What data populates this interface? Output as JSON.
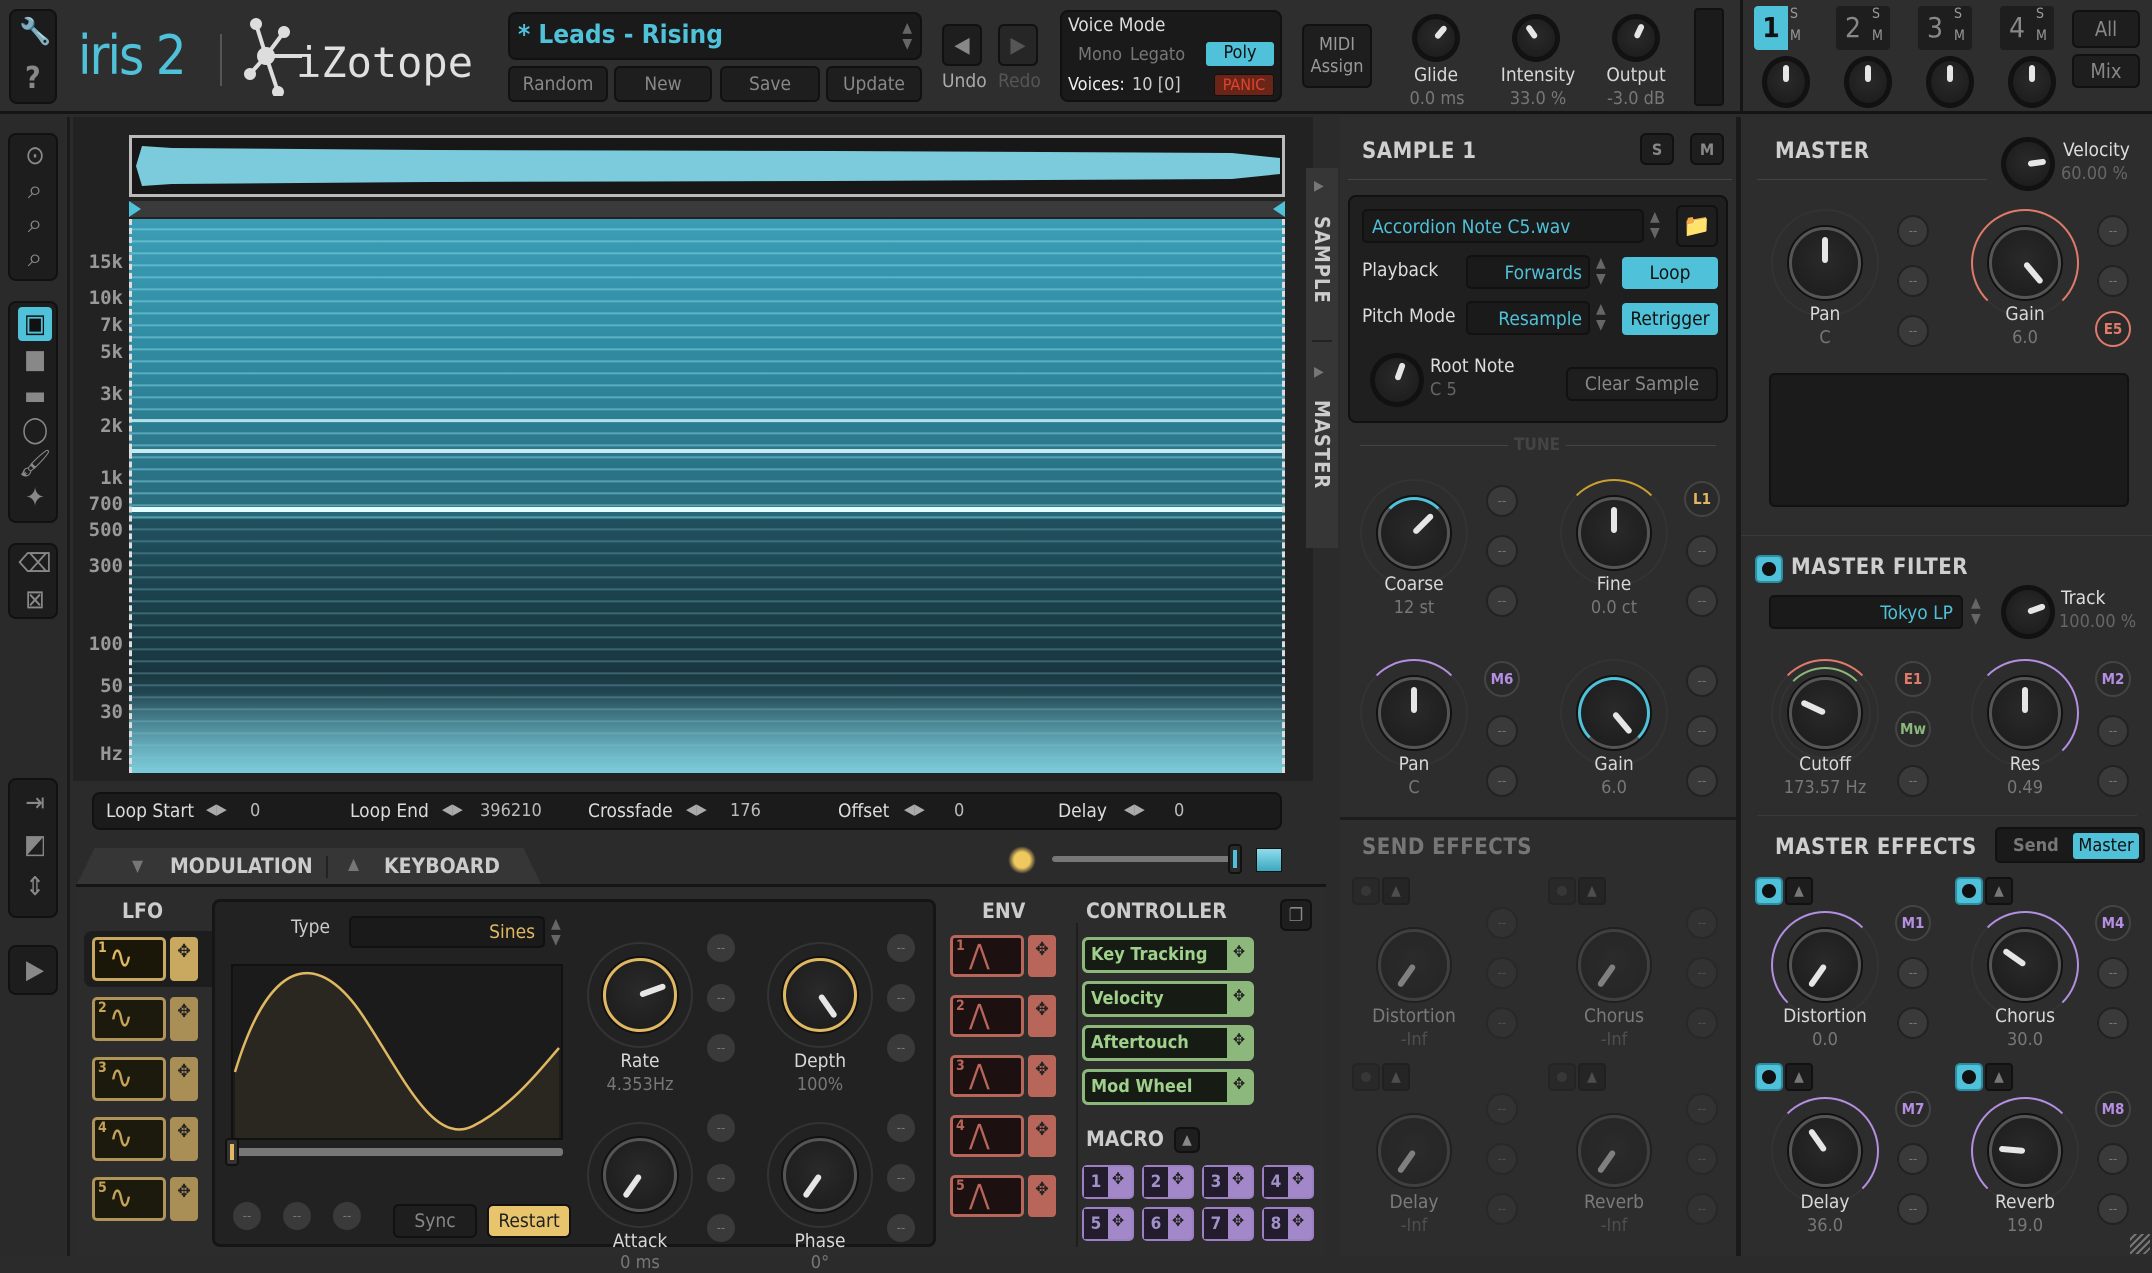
{
  "app": {
    "name": "iris 2",
    "brand": "iZotope"
  },
  "header": {
    "preset_name": "* Leads - Rising",
    "preset_buttons": [
      "Random",
      "New",
      "Save",
      "Update"
    ],
    "undo_label": "Undo",
    "redo_label": "Redo",
    "voice_mode": {
      "title": "Voice Mode",
      "options": [
        "Mono",
        "Legato",
        "Poly"
      ],
      "selected": "Poly",
      "voices_label": "Voices:",
      "voices_value": "10 [0]",
      "panic_label": "PANIC"
    },
    "midi_assign": "MIDI Assign",
    "knobs": [
      {
        "label": "Glide",
        "value": "0.0 ms"
      },
      {
        "label": "Intensity",
        "value": "33.0 %"
      },
      {
        "label": "Output",
        "value": "-3.0 dB"
      }
    ],
    "sample_slots": [
      {
        "number": "1",
        "solo": "S",
        "mute": "M",
        "active": true
      },
      {
        "number": "2",
        "solo": "S",
        "mute": "M",
        "active": false
      },
      {
        "number": "3",
        "solo": "S",
        "mute": "M",
        "active": false
      },
      {
        "number": "4",
        "solo": "S",
        "mute": "M",
        "active": false
      }
    ],
    "all_label": "All",
    "mix_label": "Mix"
  },
  "toolbar": {
    "groups": [
      [
        "zoom-select-icon",
        "zoom-out-icon",
        "zoom-icon",
        "zoom-pan-icon"
      ],
      [
        "time-frequency-select-icon",
        "rectangle-select-icon",
        "frequency-select-icon",
        "lasso-icon",
        "brush-icon",
        "magic-wand-icon"
      ],
      [
        "eraser-icon",
        "delete-selection-icon"
      ],
      [
        "move-selection-icon",
        "scale-selection-icon",
        "shift-selection-icon"
      ],
      [
        "play-selection-icon"
      ]
    ]
  },
  "spectrogram": {
    "freq_labels": [
      "15k",
      "10k",
      "7k",
      "5k",
      "3k",
      "2k",
      "1k",
      "700",
      "500",
      "300",
      "100",
      "50",
      "30",
      "Hz"
    ]
  },
  "loop_bar": {
    "fields": [
      {
        "label": "Loop Start",
        "value": "0"
      },
      {
        "label": "Loop End",
        "value": "396210"
      },
      {
        "label": "Crossfade",
        "value": "176"
      },
      {
        "label": "Offset",
        "value": "0"
      },
      {
        "label": "Delay",
        "value": "0"
      }
    ]
  },
  "bottom_tabs": {
    "modulation": "MODULATION",
    "keyboard": "KEYBOARD"
  },
  "lfo": {
    "title": "LFO",
    "slots": [
      "1",
      "2",
      "3",
      "4",
      "5"
    ],
    "type_label": "Type",
    "type_value": "Sines",
    "knobs": [
      {
        "label": "Rate",
        "value": "4.353Hz"
      },
      {
        "label": "Depth",
        "value": "100%"
      },
      {
        "label": "Attack",
        "value": "0 ms"
      },
      {
        "label": "Phase",
        "value": "0°"
      }
    ],
    "sync_label": "Sync",
    "restart_label": "Restart",
    "mod_slot_text": "--",
    "color": "#e0b862"
  },
  "env": {
    "title": "ENV",
    "slots": [
      "1",
      "2",
      "3",
      "4",
      "5"
    ],
    "color": "#b8665a"
  },
  "controller": {
    "title": "CONTROLLER",
    "items": [
      "Key Tracking",
      "Velocity",
      "Aftertouch",
      "Mod Wheel"
    ],
    "color": "#8cb87c"
  },
  "macro": {
    "title": "MACRO",
    "items": [
      "1",
      "2",
      "3",
      "4",
      "5",
      "6",
      "7",
      "8"
    ],
    "color": "#a288c8"
  },
  "side_tabs": {
    "sample": "SAMPLE",
    "master": "MASTER"
  },
  "sample_panel": {
    "title": "SAMPLE 1",
    "solo": "S",
    "mute": "M",
    "file_name": "Accordion Note C5.wav",
    "playback_label": "Playback",
    "playback_value": "Forwards",
    "loop_label": "Loop",
    "pitch_mode_label": "Pitch Mode",
    "pitch_mode_value": "Resample",
    "retrigger_label": "Retrigger",
    "root_note_label": "Root Note",
    "root_note_value": "C 5",
    "clear_sample": "Clear Sample",
    "tune_label": "TUNE",
    "knobs": [
      {
        "label": "Coarse",
        "value": "12 st"
      },
      {
        "label": "Fine",
        "value": "0.0 ct",
        "mod": "L1"
      },
      {
        "label": "Pan",
        "value": "C",
        "mod": "M6"
      },
      {
        "label": "Gain",
        "value": "6.0"
      }
    ]
  },
  "send_effects": {
    "title": "SEND EFFECTS",
    "knobs": [
      {
        "label": "Distortion",
        "value": "-Inf"
      },
      {
        "label": "Chorus",
        "value": "-Inf"
      },
      {
        "label": "Delay",
        "value": "-Inf"
      },
      {
        "label": "Reverb",
        "value": "-Inf"
      }
    ]
  },
  "master": {
    "title": "MASTER",
    "velocity_label": "Velocity",
    "velocity_value": "60.00 %",
    "knobs": [
      {
        "label": "Pan",
        "value": "C"
      },
      {
        "label": "Gain",
        "value": "6.0",
        "mod": "E5"
      }
    ]
  },
  "master_filter": {
    "title": "MASTER FILTER",
    "filter_type": "Tokyo LP",
    "track_label": "Track",
    "track_value": "100.00 %",
    "knobs": [
      {
        "label": "Cutoff",
        "value": "173.57 Hz",
        "mods": [
          "E1",
          "Mw"
        ]
      },
      {
        "label": "Res",
        "value": "0.49",
        "mods": [
          "M2"
        ]
      }
    ]
  },
  "master_effects": {
    "title": "MASTER EFFECTS",
    "toggle": [
      "Send",
      "Master"
    ],
    "selected": "Master",
    "knobs": [
      {
        "label": "Distortion",
        "value": "0.0",
        "mod": "M1"
      },
      {
        "label": "Chorus",
        "value": "30.0",
        "mod": "M4"
      },
      {
        "label": "Delay",
        "value": "36.0",
        "mod": "M7"
      },
      {
        "label": "Reverb",
        "value": "19.0",
        "mod": "M8"
      }
    ]
  },
  "colors": {
    "accent": "#4fc1d9",
    "lfo": "#e0b862",
    "env": "#b8665a",
    "controller": "#8cb87c",
    "macro": "#a288c8",
    "panic": "#6b2418"
  }
}
